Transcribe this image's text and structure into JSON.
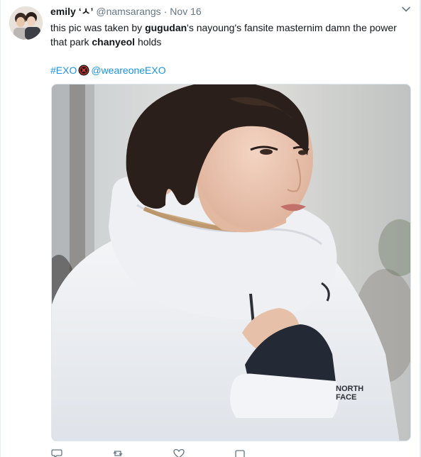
{
  "tweet": {
    "display_name": "emily ‘ㅅ’",
    "handle": "@namsarangs",
    "separator": "·",
    "timestamp": "Nov 16",
    "text_part1": "this pic was taken by ",
    "bold1": "gugudan",
    "text_part2": "'s nayoung's fansite masternim damn the power that park ",
    "bold2": "chanyeol",
    "text_part3": " holds",
    "hashtag": "#EXO",
    "emoji_icon": "exo-logo-emoji",
    "mention": "@weareoneEXO"
  },
  "colors": {
    "link": "#1b95e0",
    "text": "#14171a",
    "secondary": "#657786"
  },
  "icons": [
    "avatar-photo",
    "caret-down-icon",
    "reply-icon",
    "retweet-icon",
    "like-icon",
    "share-icon"
  ]
}
